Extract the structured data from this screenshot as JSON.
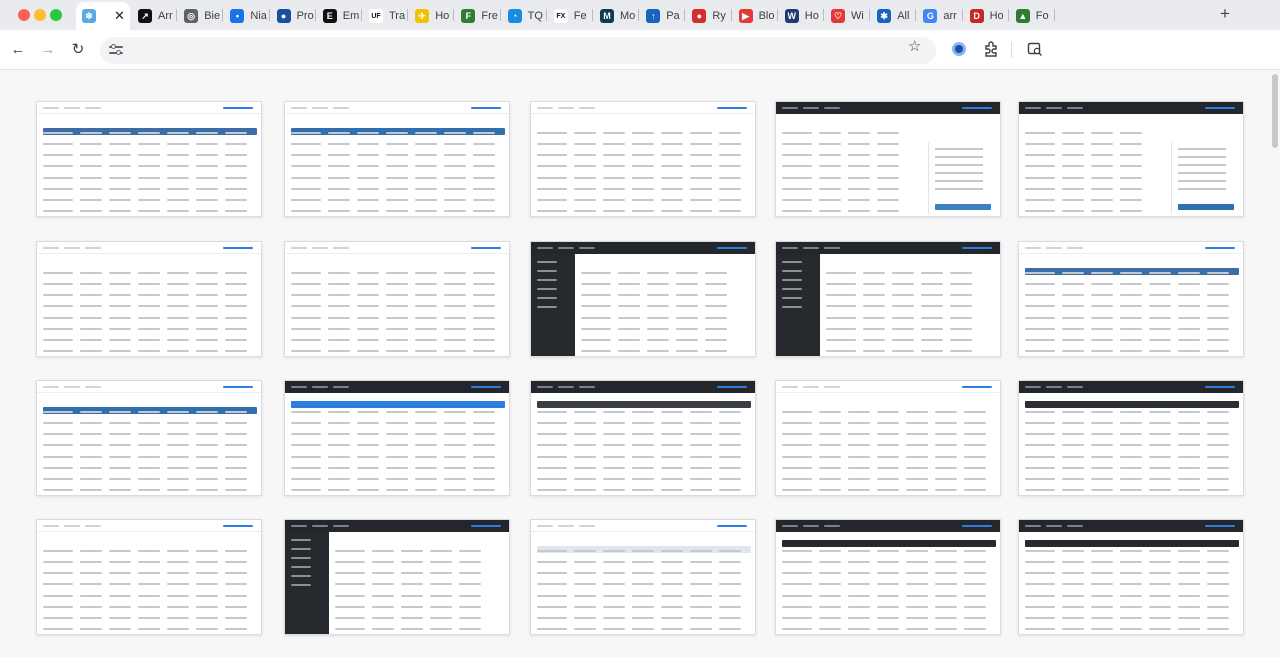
{
  "window": {
    "controls": [
      "close",
      "minimize",
      "zoom"
    ]
  },
  "tabs": [
    {
      "label": "",
      "favicon": "snowflake-icon",
      "color": "#5aa9e6",
      "glyph": "❄",
      "active": true
    },
    {
      "label": "Arr",
      "favicon": "arrow-logo-icon",
      "color": "#111111",
      "glyph": "↗"
    },
    {
      "label": "Bie",
      "favicon": "globe-icon",
      "color": "#5f6368",
      "glyph": "◎"
    },
    {
      "label": "Nia",
      "favicon": "droplet-icon",
      "color": "#1a73e8",
      "glyph": "•"
    },
    {
      "label": "Pro",
      "favicon": "blue-circle-logo-icon",
      "color": "#1a4fa0",
      "glyph": "●"
    },
    {
      "label": "Em",
      "favicon": "e-circle-icon",
      "color": "#111111",
      "glyph": "E"
    },
    {
      "label": "Tra",
      "favicon": "uf-logo-icon",
      "color": "#ffffff",
      "glyph": "UF"
    },
    {
      "label": "Ho",
      "favicon": "plane-yellow-icon",
      "color": "#f2c200",
      "glyph": "✈"
    },
    {
      "label": "Fre",
      "favicon": "fre-logo-icon",
      "color": "#2e7d32",
      "glyph": "F"
    },
    {
      "label": "TQ",
      "favicon": "blue-swoosh-icon",
      "color": "#1b8be0",
      "glyph": "◔"
    },
    {
      "label": "Fe",
      "favicon": "fedex-logo-icon",
      "color": "#ffffff",
      "glyph": "FX"
    },
    {
      "label": "Mo",
      "favicon": "dark-teal-logo-icon",
      "color": "#0b3d4f",
      "glyph": "M"
    },
    {
      "label": "Pa",
      "favicon": "blue-arrow-icon",
      "color": "#1565c0",
      "glyph": "↑"
    },
    {
      "label": "Ry",
      "favicon": "red-circle-icon",
      "color": "#d32f2f",
      "glyph": "●"
    },
    {
      "label": "Blo",
      "favicon": "red-arrow-icon",
      "color": "#e53935",
      "glyph": "▶"
    },
    {
      "label": "Ho",
      "favicon": "navy-logo-icon",
      "color": "#1f3b6f",
      "glyph": "W"
    },
    {
      "label": "Wi",
      "favicon": "heart-icon",
      "color": "#e53935",
      "glyph": "♡"
    },
    {
      "label": "All",
      "favicon": "blue-star-icon",
      "color": "#1565c0",
      "glyph": "✱"
    },
    {
      "label": "arr",
      "favicon": "google-icon",
      "color": "#4285f4",
      "glyph": "G"
    },
    {
      "label": "Ho",
      "favicon": "red-d-icon",
      "color": "#c62828",
      "glyph": "D"
    },
    {
      "label": "Fo",
      "favicon": "green-tree-icon",
      "color": "#2e7d32",
      "glyph": "▲"
    }
  ],
  "toolbar": {
    "back": "←",
    "forward": "→",
    "reload": "↻",
    "star": "☆",
    "newtab": "+"
  },
  "grid": [
    {
      "label": "tile-1",
      "theme": "light",
      "accent": "#3b6ea8"
    },
    {
      "label": "tile-2",
      "theme": "light",
      "accent": "#2f6fb0"
    },
    {
      "label": "tile-3",
      "theme": "plain",
      "accent": "#8a8f96"
    },
    {
      "label": "tile-4",
      "theme": "dark-header-panel",
      "accent": "#3b7fc4"
    },
    {
      "label": "tile-5",
      "theme": "dark-header-panel",
      "accent": "#2f6fb0"
    },
    {
      "label": "tile-6",
      "theme": "plain",
      "accent": "#3b7fc4"
    },
    {
      "label": "tile-7",
      "theme": "plain",
      "accent": "#d9534f"
    },
    {
      "label": "tile-8",
      "theme": "dark-sidebar",
      "accent": "#26292e"
    },
    {
      "label": "tile-9",
      "theme": "dark-sidebar",
      "accent": "#26292e"
    },
    {
      "label": "tile-10",
      "theme": "light",
      "accent": "#3b6ea8"
    },
    {
      "label": "tile-11",
      "theme": "light",
      "accent": "#2f6fb0"
    },
    {
      "label": "tile-12",
      "theme": "dark-header",
      "accent": "#2b7de0"
    },
    {
      "label": "tile-13",
      "theme": "dark-header",
      "accent": "#3a3d42"
    },
    {
      "label": "tile-14",
      "theme": "plain",
      "accent": "#e9ebee"
    },
    {
      "label": "tile-15",
      "theme": "dark-header",
      "accent": "#2b2e33"
    },
    {
      "label": "tile-16",
      "theme": "plain",
      "accent": "#8a8f96"
    },
    {
      "label": "tile-17",
      "theme": "dark-sidebar",
      "accent": "#26292e"
    },
    {
      "label": "tile-18",
      "theme": "light",
      "accent": "#dfe6f0"
    },
    {
      "label": "tile-19",
      "theme": "dark-header",
      "accent": "#26292e"
    },
    {
      "label": "tile-20",
      "theme": "dark-header",
      "accent": "#26292e"
    }
  ]
}
